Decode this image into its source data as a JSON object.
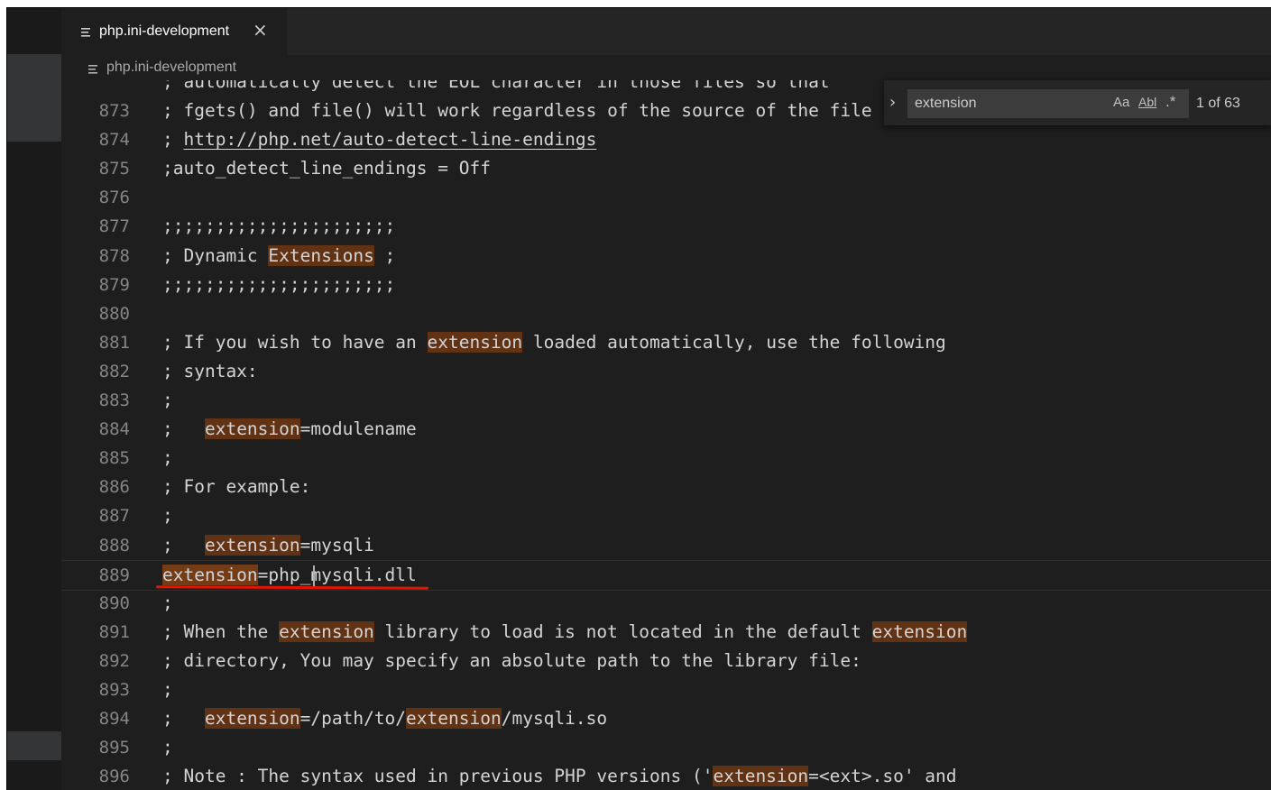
{
  "tab": {
    "title": "php.ini-development",
    "close_icon": "×"
  },
  "breadcrumb": {
    "file": "php.ini-development"
  },
  "find_widget": {
    "query": "extension",
    "match_case": "Aa",
    "whole_word": "Abl",
    "regex": ".*",
    "result_count": "1 of 63"
  },
  "editor": {
    "partial_line": "; automatically detect the EOL character in those files so that",
    "lines": [
      {
        "number": "873",
        "segments": [
          {
            "text": "; fgets() and file() will work regardless of the source of the file"
          }
        ]
      },
      {
        "number": "874",
        "segments": [
          {
            "text": "; "
          },
          {
            "text": "http://php.net/auto-detect-line-endings",
            "style": "link"
          }
        ]
      },
      {
        "number": "875",
        "segments": [
          {
            "text": ";auto_detect_line_endings = Off"
          }
        ]
      },
      {
        "number": "876",
        "segments": []
      },
      {
        "number": "877",
        "segments": [
          {
            "text": ";;;;;;;;;;;;;;;;;;;;;;"
          }
        ]
      },
      {
        "number": "878",
        "segments": [
          {
            "text": "; Dynamic "
          },
          {
            "text": "Extensions",
            "style": "match"
          },
          {
            "text": " ;"
          }
        ]
      },
      {
        "number": "879",
        "segments": [
          {
            "text": ";;;;;;;;;;;;;;;;;;;;;;"
          }
        ]
      },
      {
        "number": "880",
        "segments": []
      },
      {
        "number": "881",
        "segments": [
          {
            "text": "; If you wish to have an "
          },
          {
            "text": "extension",
            "style": "match"
          },
          {
            "text": " loaded automatically, use the following"
          }
        ]
      },
      {
        "number": "882",
        "segments": [
          {
            "text": "; syntax:"
          }
        ]
      },
      {
        "number": "883",
        "segments": [
          {
            "text": ";"
          }
        ]
      },
      {
        "number": "884",
        "segments": [
          {
            "text": ";   "
          },
          {
            "text": "extension",
            "style": "match"
          },
          {
            "text": "=modulename"
          }
        ]
      },
      {
        "number": "885",
        "segments": [
          {
            "text": ";"
          }
        ]
      },
      {
        "number": "886",
        "segments": [
          {
            "text": "; For example:"
          }
        ]
      },
      {
        "number": "887",
        "segments": [
          {
            "text": ";"
          }
        ]
      },
      {
        "number": "888",
        "segments": [
          {
            "text": ";   "
          },
          {
            "text": "extension",
            "style": "match"
          },
          {
            "text": "=mysqli"
          }
        ]
      },
      {
        "number": "889",
        "current": true,
        "segments": [
          {
            "text": "extension",
            "style": "current-match"
          },
          {
            "text": "=php_mysqli.dll"
          }
        ]
      },
      {
        "number": "890",
        "segments": [
          {
            "text": ";"
          }
        ]
      },
      {
        "number": "891",
        "segments": [
          {
            "text": "; When the "
          },
          {
            "text": "extension",
            "style": "match"
          },
          {
            "text": " library to load is not located in the default "
          },
          {
            "text": "extension",
            "style": "match"
          }
        ]
      },
      {
        "number": "892",
        "segments": [
          {
            "text": "; directory, You may specify an absolute path to the library file:"
          }
        ]
      },
      {
        "number": "893",
        "segments": [
          {
            "text": ";"
          }
        ]
      },
      {
        "number": "894",
        "segments": [
          {
            "text": ";   "
          },
          {
            "text": "extension",
            "style": "match"
          },
          {
            "text": "=/path/to/"
          },
          {
            "text": "extension",
            "style": "match"
          },
          {
            "text": "/mysqli.so"
          }
        ]
      },
      {
        "number": "895",
        "segments": [
          {
            "text": ";"
          }
        ]
      },
      {
        "number": "896",
        "segments": [
          {
            "text": "; Note : The syntax used in previous PHP versions ('"
          },
          {
            "text": "extension",
            "style": "match"
          },
          {
            "text": "=<ext>.so' and"
          }
        ]
      }
    ]
  },
  "colors": {
    "background": "#1e1e1e",
    "match_highlight": "#613214",
    "current_match": "#733c17",
    "annotation_underline": "#e51400",
    "line_number": "#858585",
    "text": "#d4d4d4"
  }
}
